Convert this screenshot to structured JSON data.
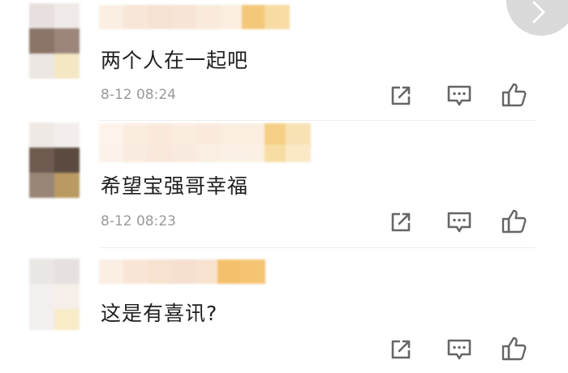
{
  "comments": [
    {
      "text": "两个人在一起吧",
      "time": "8-12 08:24",
      "actions": {
        "share_icon": "share-external-icon",
        "reply_icon": "comment-bubble-icon",
        "like_icon": "thumbs-up-icon"
      }
    },
    {
      "text": "希望宝强哥幸福",
      "time": "8-12 08:23",
      "actions": {
        "share_icon": "share-external-icon",
        "reply_icon": "comment-bubble-icon",
        "like_icon": "thumbs-up-icon"
      }
    },
    {
      "text": "这是有喜讯?",
      "time": "",
      "actions": {
        "share_icon": "share-external-icon",
        "reply_icon": "comment-bubble-icon",
        "like_icon": "thumbs-up-icon"
      }
    }
  ],
  "next_button_icon": "chevron-right-icon",
  "colors": {
    "text": "#1f1f1f",
    "timestamp": "#999999",
    "icon": "#666666",
    "nav_circle": "#d9d9d9"
  }
}
